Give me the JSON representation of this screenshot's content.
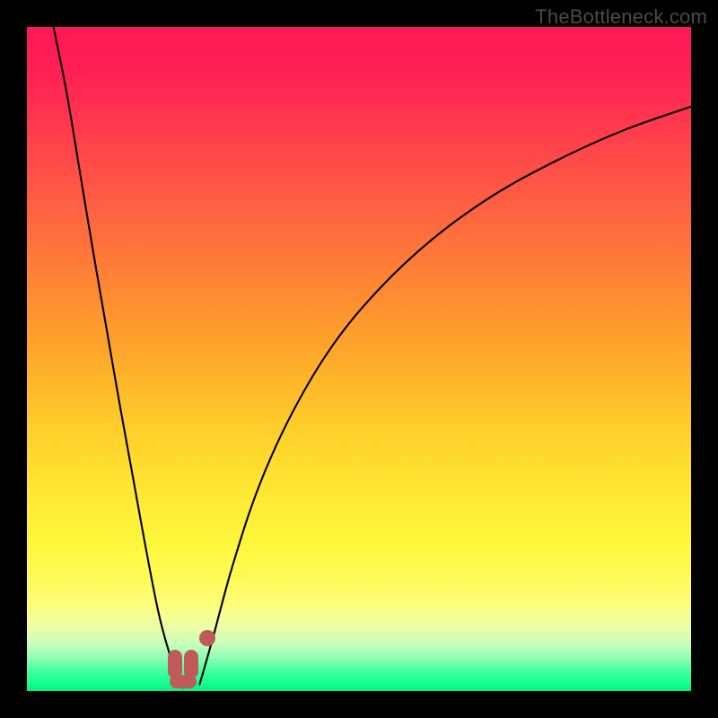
{
  "watermark": "TheBottleneck.com",
  "chart_data": {
    "type": "line",
    "title": "",
    "xlabel": "",
    "ylabel": "",
    "xlim": [
      0,
      100
    ],
    "ylim": [
      0,
      100
    ],
    "grid": false,
    "legend": false,
    "background_gradient": {
      "direction": "vertical",
      "stops": [
        {
          "pct": 0,
          "meaning": "high-bottleneck",
          "color": "#ff1756"
        },
        {
          "pct": 50,
          "meaning": "mid",
          "color": "#ffaa2a"
        },
        {
          "pct": 80,
          "meaning": "low",
          "color": "#fff83d"
        },
        {
          "pct": 100,
          "meaning": "zero-bottleneck",
          "color": "#05ed80"
        }
      ]
    },
    "series": [
      {
        "name": "left-branch",
        "x": [
          4.0,
          6.0,
          8.0,
          10.0,
          12.0,
          14.0,
          16.0,
          18.0,
          20.0,
          22.0,
          23.5
        ],
        "y": [
          100.0,
          90.0,
          78.0,
          66.0,
          54.5,
          43.0,
          32.0,
          21.0,
          11.0,
          4.0,
          0.5
        ]
      },
      {
        "name": "right-branch",
        "x": [
          26.0,
          28.0,
          31.0,
          35.0,
          40.0,
          46.0,
          53.0,
          61.0,
          70.0,
          80.0,
          90.0,
          100.0
        ],
        "y": [
          1.0,
          8.0,
          19.0,
          31.0,
          42.0,
          52.0,
          60.5,
          68.0,
          74.5,
          80.0,
          84.5,
          88.0
        ]
      }
    ],
    "annotations": [
      {
        "name": "marker-dot",
        "x": 27.2,
        "y": 8.0,
        "shape": "dot",
        "color": "#c05a58"
      },
      {
        "name": "marker-u-left",
        "x": 22.3,
        "y": 4.0,
        "shape": "pill-v",
        "color": "#c05a58"
      },
      {
        "name": "marker-u-right",
        "x": 24.7,
        "y": 4.0,
        "shape": "pill-v",
        "color": "#c05a58"
      },
      {
        "name": "marker-u-base",
        "x": 23.5,
        "y": 1.4,
        "shape": "pill-h",
        "color": "#c05a58"
      }
    ]
  }
}
